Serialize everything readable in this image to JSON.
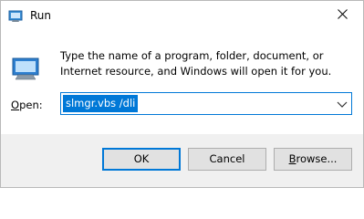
{
  "window": {
    "title": "Run",
    "close_icon": "close-icon",
    "app_icon": "run-app-icon"
  },
  "content": {
    "description": "Type the name of a program, folder, document, or Internet resource, and Windows will open it for you.",
    "open_label_first": "O",
    "open_label_rest": "pen:",
    "input_value": "slmgr.vbs /dli",
    "dropdown_icon": "chevron-down-icon"
  },
  "buttons": {
    "ok": "OK",
    "cancel": "Cancel",
    "browse_first": "B",
    "browse_rest": "rowse..."
  },
  "colors": {
    "accent": "#0078d7",
    "footer_bg": "#f0f0f0",
    "button_bg": "#e1e1e1"
  }
}
